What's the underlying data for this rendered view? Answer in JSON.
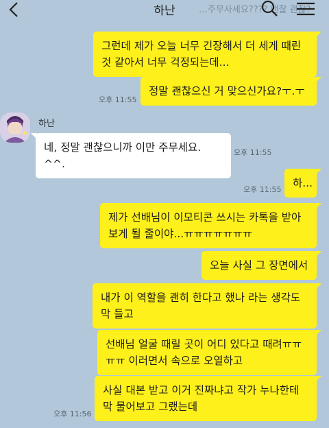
{
  "header": {
    "title": "하난",
    "ghost_text": "…주무사세요???? 앤찰 괜찮?"
  },
  "messages": [
    {
      "text": "그런데 제가 오늘 너무 긴장해서 더 세게 때린 것 같아서 너무 걱정되는데..."
    },
    {
      "text": "정말 괜찮으신 거 맞으신가요?ㅜ.ㅜ",
      "time": "오후 11:55"
    },
    {
      "sender": "하난",
      "text": "네, 정말 괜찮으니까 이만 주무세요. ^^.",
      "time": "오후 11:55"
    },
    {
      "text": "하...",
      "time": "오후 11:55"
    },
    {
      "text": "제가 선배님이 이모티콘 쓰시는 카톡을 받아 보게 될 줄이야...ㅠㅠㅠㅠㅠㅠㅠ"
    },
    {
      "text": "오늘 사실 그 장면에서"
    },
    {
      "text": "내가 이 역할을 괜히 한다고 했나 라는 생각도 막 들고"
    },
    {
      "text": "선배님 얼굴 때릴 곳이 어디 있다고 때려ㅠㅠ ㅠㅠ 이러면서 속으로 오열하고"
    },
    {
      "text": "사실 대본 받고 이거 진짜냐고 작가 누나한테 막 물어보고 그랬는데",
      "time": "오후 11:56"
    }
  ]
}
